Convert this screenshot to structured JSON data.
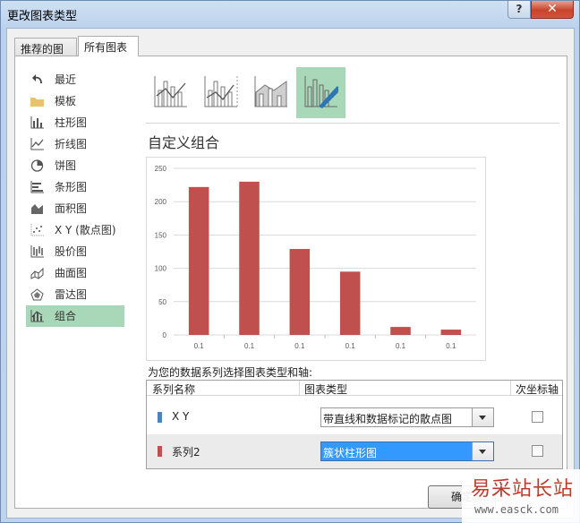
{
  "window": {
    "title": "更改图表类型",
    "help_label": "?",
    "close_label": "✕"
  },
  "tabs": [
    {
      "label": "推荐的图表"
    },
    {
      "label": "所有图表"
    }
  ],
  "sidebar": {
    "items": [
      {
        "label": "最近",
        "icon": "undo-icon"
      },
      {
        "label": "模板",
        "icon": "folder-icon"
      },
      {
        "label": "柱形图",
        "icon": "column-chart-icon"
      },
      {
        "label": "折线图",
        "icon": "line-chart-icon"
      },
      {
        "label": "饼图",
        "icon": "pie-chart-icon"
      },
      {
        "label": "条形图",
        "icon": "bar-chart-icon"
      },
      {
        "label": "面积图",
        "icon": "area-chart-icon"
      },
      {
        "label": "X Y (散点图)",
        "icon": "scatter-chart-icon"
      },
      {
        "label": "股价图",
        "icon": "stock-chart-icon"
      },
      {
        "label": "曲面图",
        "icon": "surface-chart-icon"
      },
      {
        "label": "雷达图",
        "icon": "radar-chart-icon"
      },
      {
        "label": "组合",
        "icon": "combo-chart-icon"
      }
    ],
    "selected_index": 11
  },
  "combo_types": [
    {
      "icon": "clustered-column-line-icon"
    },
    {
      "icon": "clustered-column-line-secondary-axis-icon"
    },
    {
      "icon": "stacked-area-clustered-column-icon"
    },
    {
      "icon": "custom-combination-icon"
    }
  ],
  "heading": "自定义组合",
  "chart_data": {
    "type": "bar",
    "categories": [
      "0.1",
      "0.1",
      "0.1",
      "0.1",
      "0.1",
      "0.1"
    ],
    "series": [
      {
        "values": [
          222,
          230,
          129,
          95,
          12,
          8
        ]
      }
    ],
    "ylim": [
      0,
      250
    ],
    "yticks": [
      0,
      50,
      100,
      150,
      200,
      250
    ],
    "grid": true,
    "color": "#c0504d"
  },
  "choose_label": "为您的数据系列选择图表类型和轴:",
  "series_table": {
    "headers": {
      "name": "系列名称",
      "type": "图表类型",
      "secondary": "次坐标轴"
    },
    "rows": [
      {
        "name": "X Y",
        "color": "#4f81bd",
        "chart_type": "带直线和数据标记的散点图",
        "secondary_axis": false
      },
      {
        "name": "系列2",
        "color": "#c0504d",
        "chart_type": "簇状柱形图",
        "secondary_axis": false
      }
    ]
  },
  "ok_label": "确定",
  "watermark": {
    "text": "易采站长站",
    "url": "www.easck.com"
  }
}
